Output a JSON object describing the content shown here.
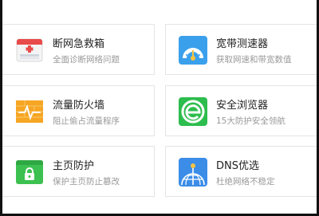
{
  "tools": [
    {
      "title": "断网急救箱",
      "desc": "全面诊断网络问题",
      "icon": "first-aid-kit-icon",
      "color": "#e94b4b"
    },
    {
      "title": "宽带测速器",
      "desc": "获取网速和带宽数值",
      "icon": "speedometer-icon",
      "color": "#3aa0ec"
    },
    {
      "title": "流量防火墙",
      "desc": "阻止偷占流量程序",
      "icon": "firewall-icon",
      "color": "#f6a623"
    },
    {
      "title": "安全浏览器",
      "desc": "15大防护安全领航",
      "icon": "browser-logo-icon",
      "color": "#2dbd4e"
    },
    {
      "title": "主页防护",
      "desc": "保护主页防止篡改",
      "icon": "homepage-lock-icon",
      "color": "#3cc150"
    },
    {
      "title": "DNS优选",
      "desc": "杜绝网络不稳定",
      "icon": "dns-globe-icon",
      "color": "#3b8de8"
    }
  ]
}
